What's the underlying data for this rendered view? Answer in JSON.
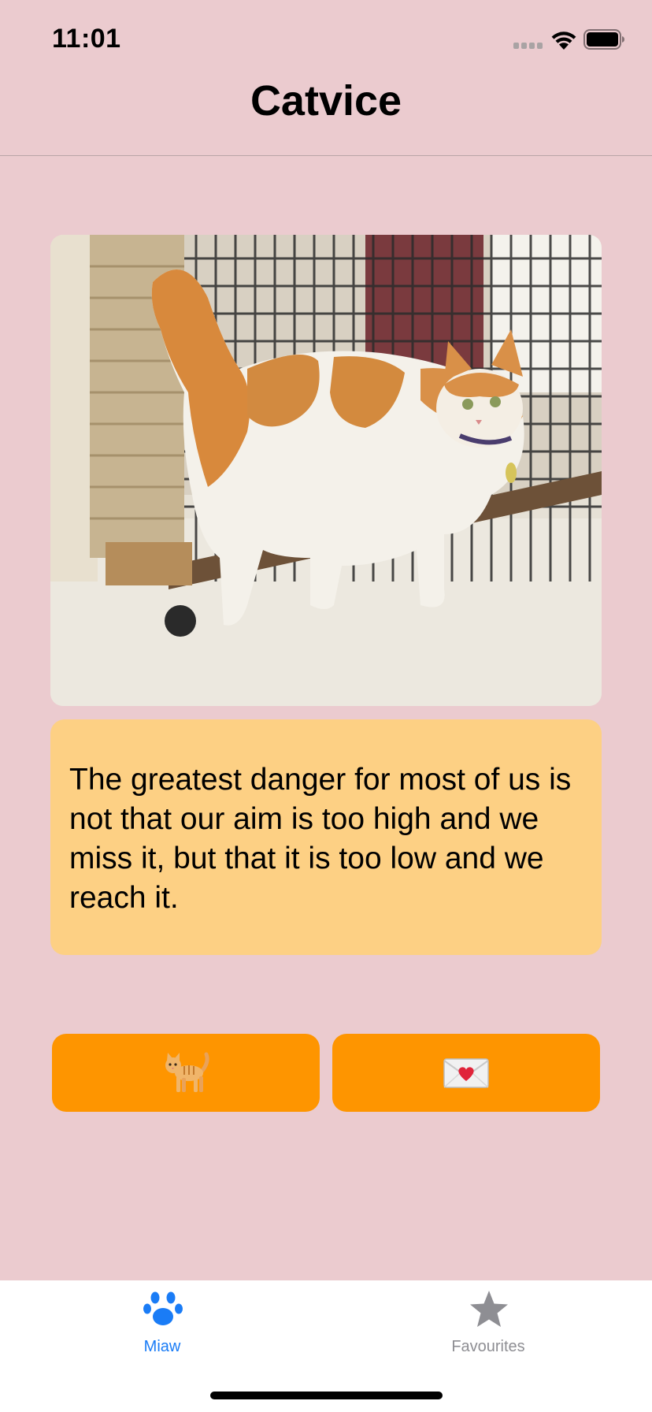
{
  "status_bar": {
    "time": "11:01"
  },
  "nav": {
    "title": "Catvice"
  },
  "cat_image": {
    "description_icon": "cat-photo"
  },
  "quote": {
    "text": "The greatest danger for most of us is not that our aim is too high and we miss it, but that it is too low and we reach it."
  },
  "buttons": {
    "new_cat": {
      "icon": "cat-emoji-icon"
    },
    "save_favourite": {
      "icon": "heart-envelope-emoji-icon"
    }
  },
  "tab_bar": {
    "items": [
      {
        "label": "Miaw",
        "icon": "paw-icon",
        "selected": true
      },
      {
        "label": "Favourites",
        "icon": "star-icon",
        "selected": false
      }
    ]
  },
  "colors": {
    "background": "#ebcbcf",
    "quote_card": "#fdd084",
    "button": "#fe9500",
    "tab_active": "#1a7cf6",
    "tab_inactive": "#8e8e93"
  }
}
